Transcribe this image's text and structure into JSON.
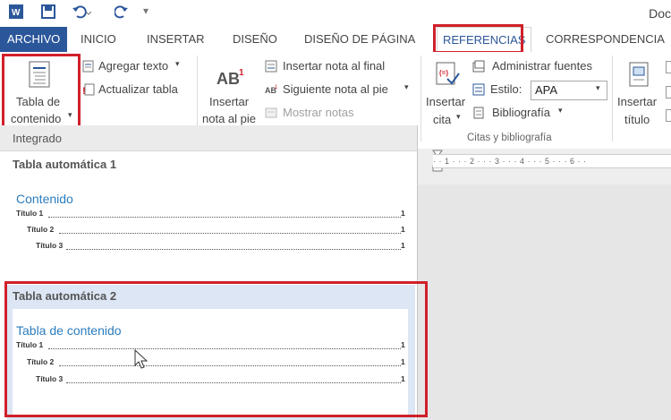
{
  "window": {
    "doc_title": "Doc"
  },
  "colors": {
    "accent": "#2b579a",
    "highlight_red": "#d0202a",
    "toc_heading": "#2b7cbd"
  },
  "tabs": [
    "ARCHIVO",
    "INICIO",
    "INSERTAR",
    "DISEÑO",
    "DISEÑO DE PÁGINA",
    "REFERENCIAS",
    "CORRESPONDENCIA"
  ],
  "ribbon": {
    "toc_button": {
      "line1": "Tabla de",
      "line2": "contenido"
    },
    "agregar_texto": "Agregar texto",
    "actualizar_tabla": "Actualizar tabla",
    "insertar_nota_pie": {
      "line1": "Insertar",
      "line2": "nota al pie"
    },
    "insertar_nota_final": "Insertar nota al final",
    "siguiente_nota": "Siguiente nota al pie",
    "mostrar_notas": "Mostrar notas",
    "insertar_cita": {
      "line1": "Insertar",
      "line2": "cita"
    },
    "administrar_fuentes": "Administrar fuentes",
    "estilo_label": "Estilo:",
    "estilo_value": "APA",
    "bibliografia": "Bibliografía",
    "citas_group": "Citas y bibliografía",
    "insertar_titulo": {
      "line1": "Insertar",
      "line2": "título"
    }
  },
  "ruler": {
    "ticks": "· · 1 · · · 2 · · · 3 · · · 4 · · · 5 · · · 6 · ·"
  },
  "dropdown": {
    "header": "Integrado",
    "option1": {
      "title": "Tabla automática 1",
      "heading": "Contenido",
      "entries": [
        {
          "text": "Título 1",
          "page": "1"
        },
        {
          "text": "Título 2",
          "page": "1"
        },
        {
          "text": "Título 3",
          "page": "1"
        }
      ]
    },
    "option2": {
      "title": "Tabla automática 2",
      "heading": "Tabla de contenido",
      "entries": [
        {
          "text": "Título 1",
          "page": "1"
        },
        {
          "text": "Título 2",
          "page": "1"
        },
        {
          "text": "Título 3",
          "page": "1"
        }
      ]
    }
  }
}
